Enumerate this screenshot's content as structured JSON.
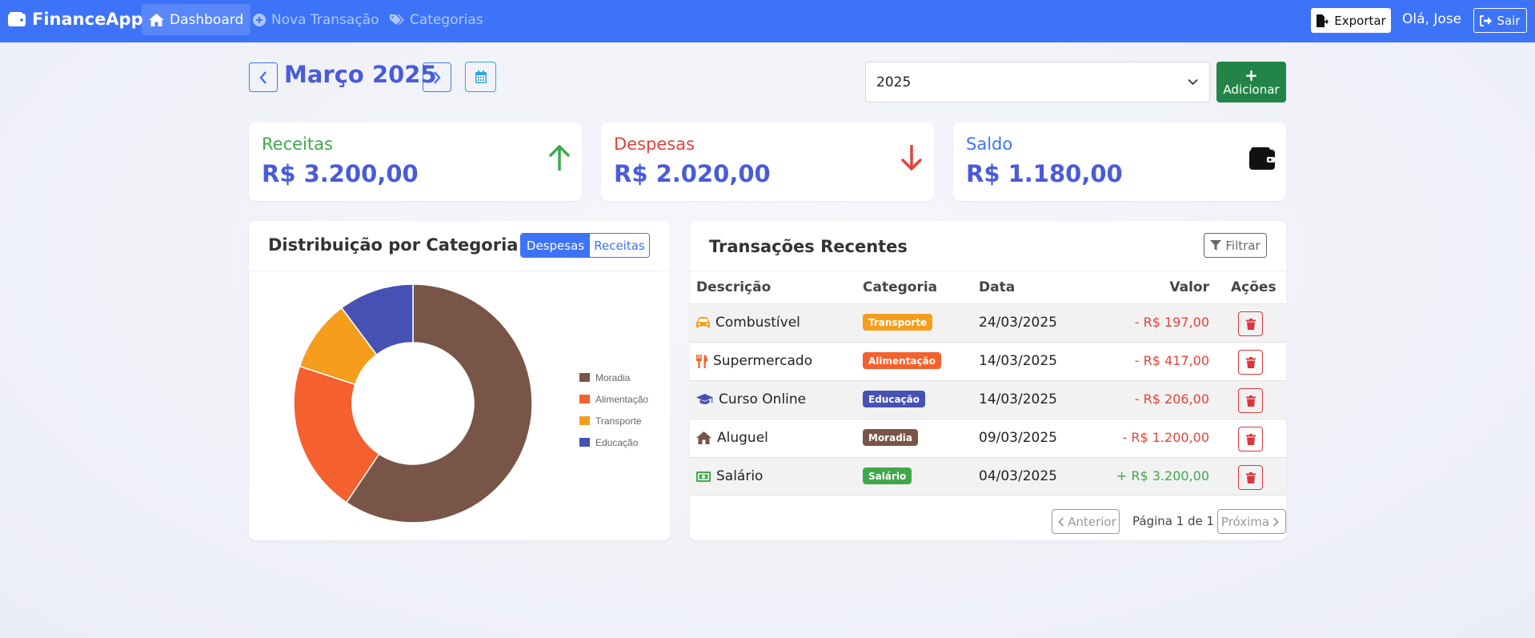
{
  "navbar": {
    "brand": "FinanceApp",
    "items": [
      {
        "label": "Dashboard",
        "icon": "home-icon",
        "active": true
      },
      {
        "label": "Nova Transação",
        "icon": "plus-circle-icon",
        "active": false
      },
      {
        "label": "Categorias",
        "icon": "tags-icon",
        "active": false
      }
    ],
    "export_label": "Exportar",
    "greeting": "Olá, Jose",
    "logout_label": "Sair"
  },
  "header": {
    "month_title": "Março 2025",
    "year_selected": "2025",
    "add_label": "Adicionar",
    "add_plus": "+"
  },
  "summary": {
    "income": {
      "label": "Receitas",
      "value": "R$ 3.200,00",
      "color": "#3ea84a"
    },
    "expenses": {
      "label": "Despesas",
      "value": "R$ 2.020,00",
      "color": "#e0443a"
    },
    "balance": {
      "label": "Saldo",
      "value": "R$ 1.180,00",
      "color": "#3d73f7"
    }
  },
  "chart_card": {
    "title": "Distribuição por Categoria",
    "toggle": {
      "expenses": "Despesas",
      "income": "Receitas"
    }
  },
  "chart_data": {
    "type": "pie",
    "categories": [
      "Moradia",
      "Alimentação",
      "Transporte",
      "Educação"
    ],
    "values": [
      1200,
      417,
      197,
      206
    ],
    "colors": [
      "#795548",
      "#f4602e",
      "#f59e1e",
      "#4651b4"
    ],
    "title": "",
    "legend": "right",
    "donut": true
  },
  "transactions": {
    "title": "Transações Recentes",
    "filter_label": "Filtrar",
    "columns": {
      "desc": "Descrição",
      "cat": "Categoria",
      "date": "Data",
      "value": "Valor",
      "actions": "Ações"
    },
    "rows": [
      {
        "desc": "Combustível",
        "icon": "car-icon",
        "icon_color": "#f59e1e",
        "category": "Transporte",
        "cat_color": "#f59e1e",
        "date": "24/03/2025",
        "value": "- R$ 197,00",
        "value_color": "#e0443a"
      },
      {
        "desc": "Supermercado",
        "icon": "utensils-icon",
        "icon_color": "#f4602e",
        "category": "Alimentação",
        "cat_color": "#f4602e",
        "date": "14/03/2025",
        "value": "- R$ 417,00",
        "value_color": "#e0443a"
      },
      {
        "desc": "Curso Online",
        "icon": "graduation-cap-icon",
        "icon_color": "#4651b4",
        "category": "Educação",
        "cat_color": "#4651b4",
        "date": "14/03/2025",
        "value": "- R$ 206,00",
        "value_color": "#e0443a"
      },
      {
        "desc": "Aluguel",
        "icon": "house-icon",
        "icon_color": "#795548",
        "category": "Moradia",
        "cat_color": "#795548",
        "date": "09/03/2025",
        "value": "- R$ 1.200,00",
        "value_color": "#e0443a"
      },
      {
        "desc": "Salário",
        "icon": "money-bill-icon",
        "icon_color": "#3ea84a",
        "category": "Salário",
        "cat_color": "#3ea84a",
        "date": "04/03/2025",
        "value": "+ R$ 3.200,00",
        "value_color": "#3ea84a"
      }
    ],
    "pager": {
      "prev": "Anterior",
      "info": "Página 1 de 1",
      "next": "Próxima"
    }
  }
}
